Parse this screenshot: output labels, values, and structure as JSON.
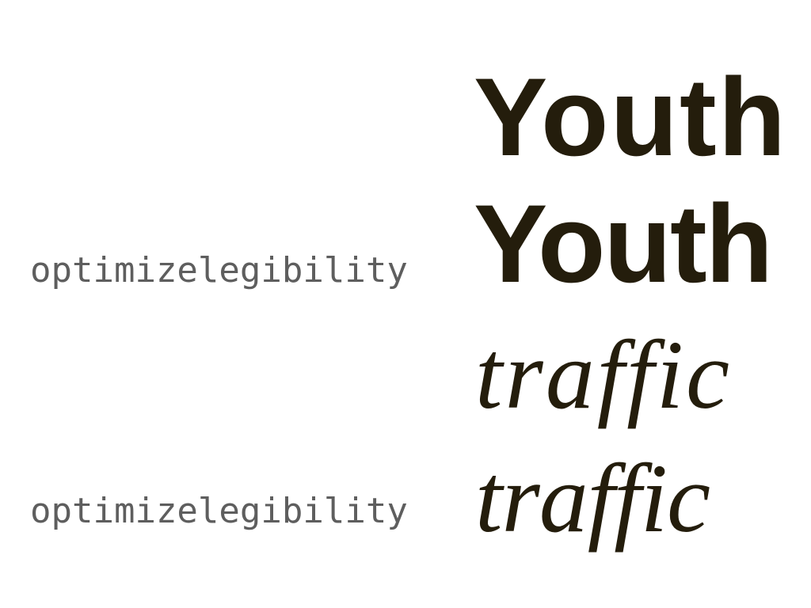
{
  "rows": [
    {
      "label": "optimizelegibility",
      "sample_sans": "Youth",
      "sample_serif": "traffic"
    }
  ],
  "label_top": "optimizelegibility",
  "label_bottom": "optimizelegibility",
  "samples": {
    "sans_1": "Youth",
    "sans_2": "Youth",
    "serif_1": "traffic",
    "serif_2": "traffic"
  },
  "colors": {
    "label": "#5e5e5e",
    "sample": "#241d0c",
    "background": "#ffffff"
  }
}
